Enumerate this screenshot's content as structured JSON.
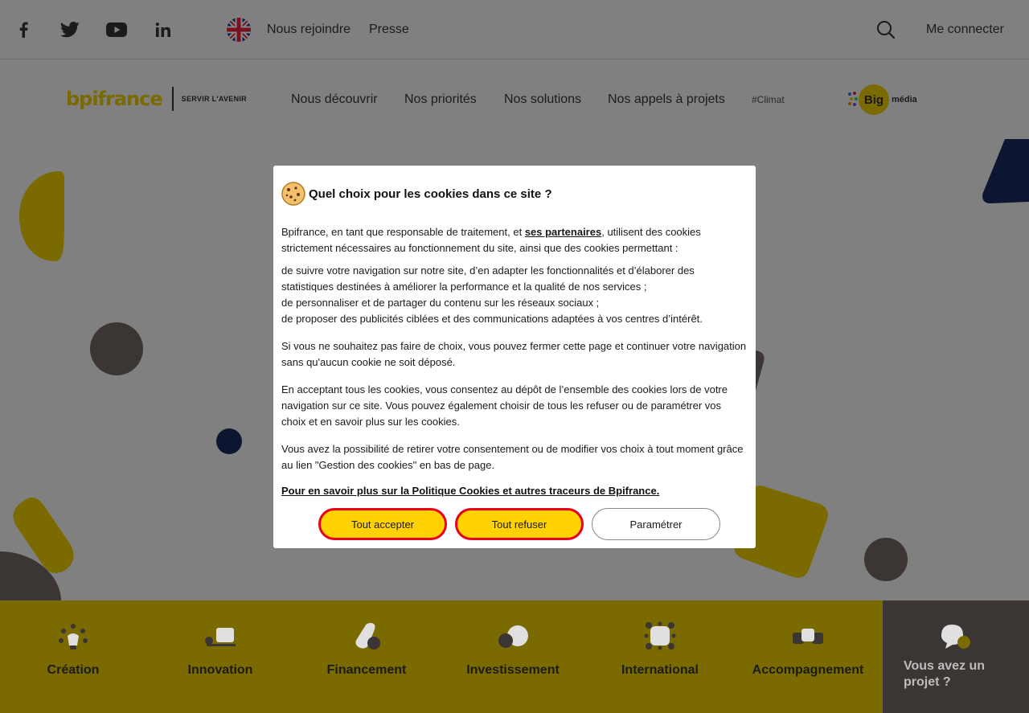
{
  "topbar": {
    "social": [
      {
        "name": "facebook-icon"
      },
      {
        "name": "twitter-icon"
      },
      {
        "name": "youtube-icon"
      },
      {
        "name": "linkedin-icon"
      }
    ],
    "language_icon": "uk-flag-icon",
    "links": {
      "join": "Nous rejoindre",
      "press": "Presse"
    },
    "login": "Me connecter"
  },
  "nav": {
    "logo_text": "bpifrance",
    "logo_tagline": "SERVIR L'AVENIR",
    "items": [
      "Nous découvrir",
      "Nos priorités",
      "Nos solutions",
      "Nos appels à projets"
    ],
    "hashtag": "#Climat",
    "bigmedia": {
      "big": "Big",
      "media": "média"
    }
  },
  "cookie_modal": {
    "title": "Quel choix pour les cookies dans ce site ?",
    "intro_before": "Bpifrance, en tant que responsable de traitement, et ",
    "partners_link": "ses partenaires",
    "intro_after": ", utilisent des cookies strictement nécessaires au fonctionnement du site, ainsi que des cookies permettant :",
    "purposes": [
      "de suivre votre navigation sur notre site, d’en adapter les fonctionnalités et d’élaborer des statistiques destinées à améliorer la performance et la qualité de nos services ;",
      "de personnaliser et de partager du contenu sur les réseaux sociaux ;",
      "de proposer des publicités ciblées et des communications adaptées à vos centres d’intérêt."
    ],
    "no_choice": "Si vous ne souhaitez pas faire de choix, vous pouvez fermer cette page et continuer votre navigation sans qu'aucun cookie ne soit déposé.",
    "accept_info": "En acceptant tous les cookies, vous consentez au dépôt de l’ensemble des cookies lors de votre navigation sur ce site. Vous pouvez également choisir de tous les refuser ou de paramétrer vos choix et en savoir plus sur les cookies.",
    "withdraw_info": "Vous avez la possibilité de retirer votre consentement ou de modifier vos choix à tout moment grâce au lien \"Gestion des cookies\" en bas de page.",
    "policy_link": "Pour en savoir plus sur la Politique Cookies et autres traceurs de Bpifrance.",
    "buttons": {
      "accept": "Tout accepter",
      "refuse": "Tout refuser",
      "settings": "Paramétrer"
    }
  },
  "bottom_nav": {
    "items": [
      {
        "label": "Création",
        "icon": "lightbulb-icon"
      },
      {
        "label": "Innovation",
        "icon": "innovation-icon"
      },
      {
        "label": "Financement",
        "icon": "financing-icon"
      },
      {
        "label": "Investissement",
        "icon": "investment-icon"
      },
      {
        "label": "International",
        "icon": "international-icon"
      },
      {
        "label": "Accompagnement",
        "icon": "support-icon"
      }
    ],
    "project": {
      "label": "Vous avez un projet ?",
      "icon": "chat-bubbles-icon"
    }
  },
  "colors": {
    "overlay": "#808080",
    "brand_yellow": "#ffd200",
    "dimmed_yellow": "#7a6a00",
    "accent_red": "#e8001c",
    "dark": "#3b3533"
  }
}
